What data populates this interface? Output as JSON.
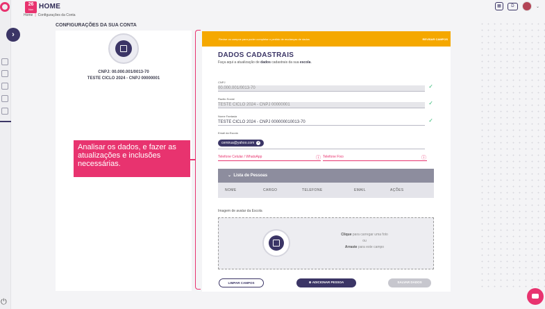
{
  "header": {
    "date_day": "26",
    "date_month": "Nov",
    "title": "HOME",
    "breadcrumb": [
      "Home",
      "Configurações da Conta"
    ],
    "icon_d": "D"
  },
  "account": {
    "section_title": "CONFIGURAÇÕES DA SUA CONTA",
    "cnpj": "CNPJ: 00.000.001/0013-70",
    "name": "TESTE CICLO 2024 - CNPJ 00000001"
  },
  "callout": {
    "text": "Analisar os dados, e fazer as atualizações e inclusões necessárias."
  },
  "form": {
    "banner_message": "Revise os campos para poder completar o pedido de mudanças de dados",
    "banner_action": "REVISAR CAMPOS",
    "title": "DADOS CADASTRAIS",
    "subtitle_pre": "Faça aqui a atualização de ",
    "subtitle_bold1": "dados",
    "subtitle_mid": " cadastrais da sua ",
    "subtitle_bold2": "escola",
    "subtitle_end": ".",
    "cnpj_label": "CNPJ",
    "cnpj_value": "00.000.001/0013-70",
    "razao_label": "Razão Social",
    "razao_value": "TESTE CICLO 2024 - CNPJ 00000001",
    "fantasia_label": "Nome Fantasia",
    "fantasia_value": "TESTE CICLO 2024 - CNPJ 000000010013-70",
    "email_label": "Email da Escola",
    "email_chip": "cemirua@yahoo.com",
    "celular_placeholder": "Telefone Celular / WhatsApp",
    "fixo_placeholder": "Telefone Fixo",
    "people_title": "Lista de Pessoas",
    "people_columns": [
      "NOME",
      "CARGO",
      "TELEFONE",
      "EMAIL",
      "AÇÕES"
    ],
    "avatar_label": "Imagem de avatar da Escola",
    "drop_click_bold": "Clique",
    "drop_click_rest": " para carregar uma foto",
    "drop_or": "ou",
    "drop_drag_bold": "Arraste",
    "drop_drag_rest": " para este campo",
    "btn_clear": "LIMPAR CAMPOS",
    "btn_add": "ADICIONAR PESSOA",
    "btn_save": "SALVAR DADOS"
  },
  "colors": {
    "accent": "#e8336f",
    "primary": "#3b3566",
    "warning": "#f5a800",
    "success": "#2eb872"
  }
}
